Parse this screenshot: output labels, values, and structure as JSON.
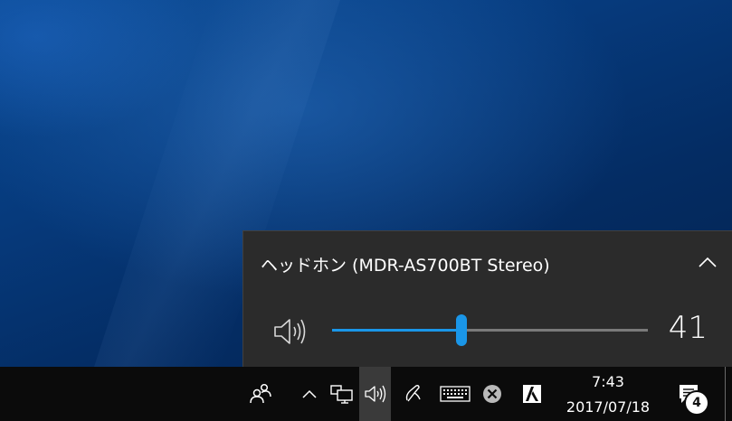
{
  "volume_flyout": {
    "device_name": "ヘッドホン (MDR-AS700BT Stereo)",
    "volume_value": "41",
    "volume_level": 0.41,
    "accent_color": "#1a96e8",
    "expand_icon": "chevron-up-icon",
    "speaker_icon": "speaker-icon"
  },
  "taskbar": {
    "tray_icons": [
      "people-icon",
      "chevron-up-icon",
      "network-icon",
      "speaker-icon",
      "pen-icon",
      "keyboard-icon",
      "close-circle-icon",
      "ime-icon"
    ],
    "clock": {
      "time": "7:43",
      "date": "2017/07/18"
    },
    "notifications": {
      "icon": "action-center-icon",
      "count": "4"
    }
  }
}
